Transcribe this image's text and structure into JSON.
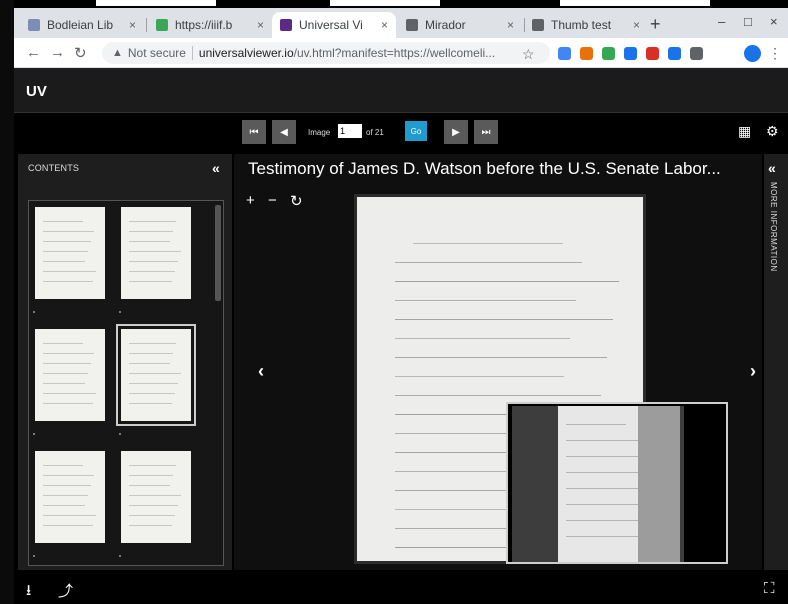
{
  "browser": {
    "tabs": [
      {
        "title": "Bodleian Lib",
        "favicon_color": "#7b8fb5",
        "active": false
      },
      {
        "title": "https://iiif.b",
        "favicon_color": "#3aa757",
        "active": false
      },
      {
        "title": "Universal Vi",
        "favicon_color": "#5b2a86",
        "active": true
      },
      {
        "title": "Mirador",
        "favicon_color": "#5f6368",
        "active": false
      },
      {
        "title": "Thumb test",
        "favicon_color": "#5f6368",
        "active": false
      }
    ],
    "tab_close": "×",
    "new_tab": "+",
    "window_controls": {
      "minimize": "–",
      "maximize": "□",
      "close": "×"
    },
    "nav": {
      "back": "←",
      "forward": "→",
      "reload": "↻"
    },
    "security": {
      "icon": "warning-icon",
      "label": "Not secure"
    },
    "url_host": "universalviewer.io",
    "url_rest": "/uv.html?manifest=https://wellcomeli...",
    "bookmark": "☆",
    "extensions": [
      "#4285f4",
      "#e8710a",
      "#34a853",
      "#1a73e8",
      "#d93025",
      "#1a73e8",
      "#5f6368"
    ],
    "menu": "⋮"
  },
  "viewer": {
    "logo": "UV",
    "pager": {
      "first": "⏮",
      "prev": "◀",
      "image_label": "Image",
      "current": "1",
      "of_label": "of 21",
      "go_label": "Go",
      "next": "▶",
      "last": "⏭"
    },
    "gallery_icon": "▦",
    "settings_icon": "⚙",
    "left_panel": {
      "title": "CONTENTS",
      "collapse": "«"
    },
    "doc_title": "Testimony of James D. Watson before the U.S. Senate Labor...",
    "zoom": {
      "in": "+",
      "out": "−",
      "rotate": "↻"
    },
    "prev_arrow": "‹",
    "next_arrow": "›",
    "right_panel": {
      "collapse": "«",
      "label": "MORE INFORMATION"
    },
    "footer": {
      "download": "⭳",
      "share": "⤴",
      "fullscreen": "⛶"
    }
  }
}
